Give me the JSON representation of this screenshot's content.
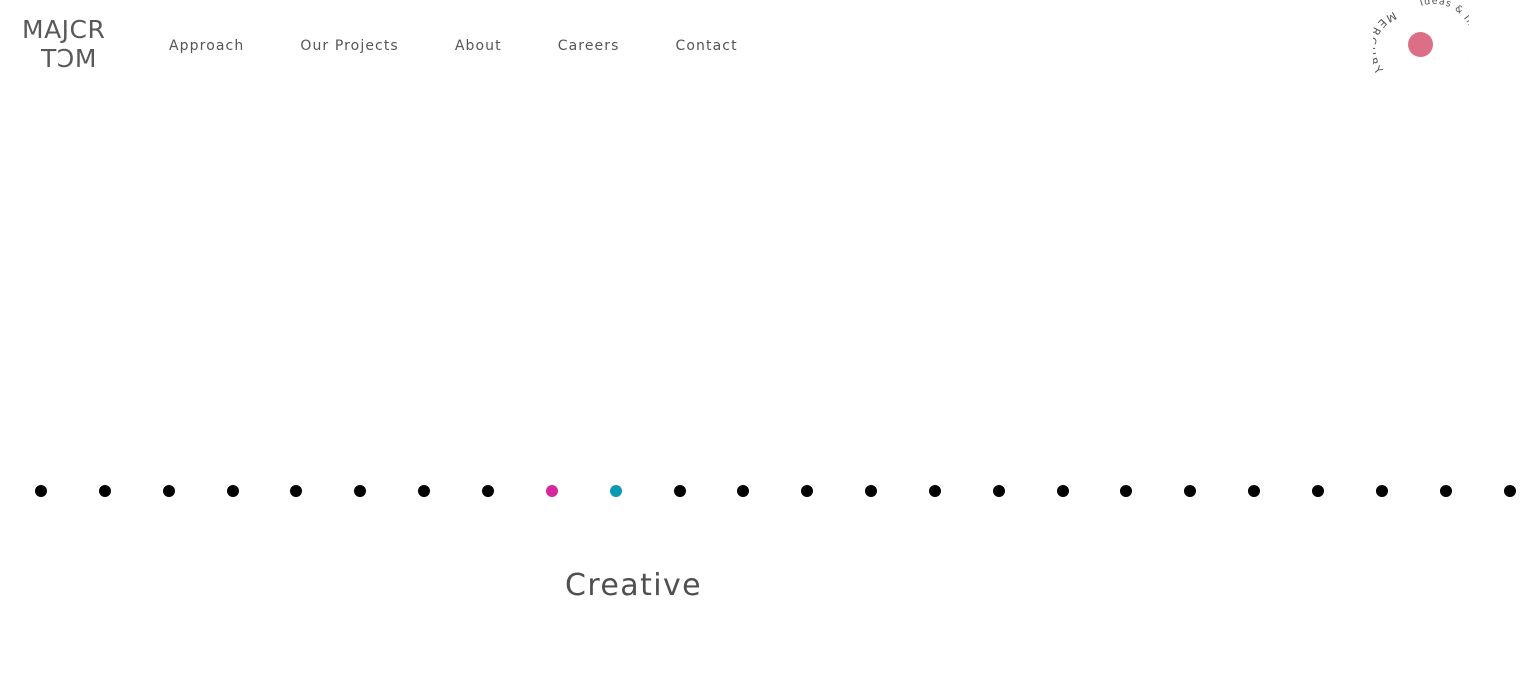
{
  "logo": {
    "line1": "MAJCR",
    "line2": "TƆM"
  },
  "nav": {
    "items": [
      {
        "label": "Approach"
      },
      {
        "label": "Our Projects"
      },
      {
        "label": "About"
      },
      {
        "label": "Careers"
      },
      {
        "label": "Contact"
      }
    ]
  },
  "badge": {
    "name": "MERCURY",
    "tagline": "Ideas & Insights",
    "dot_color": "#dc6f86",
    "text_color": "#555555"
  },
  "timeline": {
    "dot_count": 24,
    "default_color": "#000000",
    "highlighted": [
      {
        "index": 8,
        "color": "#d6289c"
      },
      {
        "index": 9,
        "color": "#0e99b2"
      }
    ]
  },
  "caption": {
    "text": "Creative"
  }
}
